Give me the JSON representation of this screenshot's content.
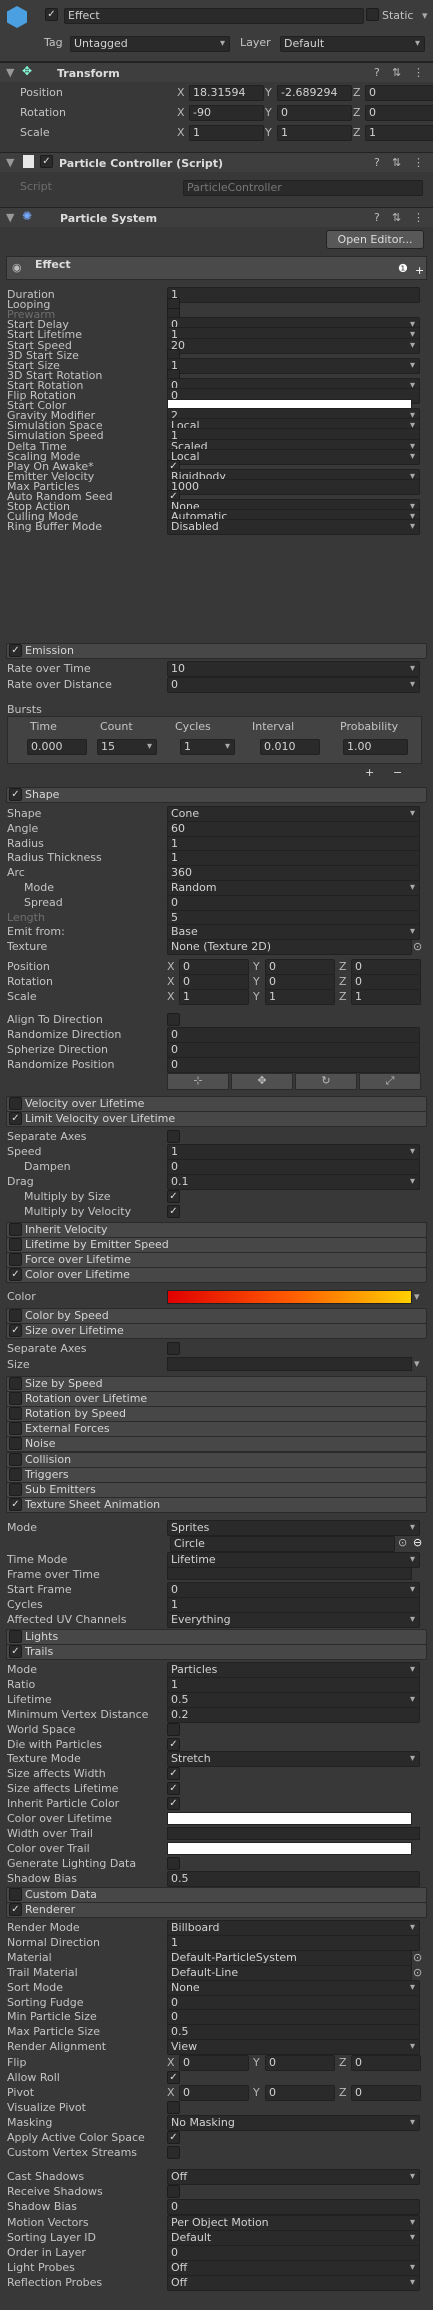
{
  "object": {
    "name": "Effect",
    "static_label": "Static",
    "tag_label": "Tag",
    "tag_value": "Untagged",
    "layer_label": "Layer",
    "layer_value": "Default"
  },
  "transform": {
    "title": "Transform",
    "pos_label": "Position",
    "rot_label": "Rotation",
    "scale_label": "Scale",
    "pos": [
      "18.31594",
      "-2.689294",
      "0"
    ],
    "rot": [
      "-90",
      "0",
      "0"
    ],
    "scale": [
      "1",
      "1",
      "1"
    ]
  },
  "controller": {
    "title": "Particle Controller (Script)",
    "script_label": "Script",
    "script_value": "ParticleController"
  },
  "ps": {
    "title": "Particle System",
    "open_editor": "Open Editor...",
    "effect_tab": "Effect"
  },
  "main_rows": [
    {
      "l": "Duration",
      "v": "1",
      "k": "field"
    },
    {
      "l": "Looping",
      "v": "",
      "k": "check"
    },
    {
      "l": "Prewarm",
      "v": "",
      "k": "dim"
    },
    {
      "l": "Start Delay",
      "v": "0",
      "k": "dd"
    },
    {
      "l": "Start Lifetime",
      "v": "1",
      "k": "dd"
    },
    {
      "l": "Start Speed",
      "v": "20",
      "k": "dd"
    },
    {
      "l": "3D Start Size",
      "v": "",
      "k": "check"
    },
    {
      "l": "Start Size",
      "v": "1",
      "k": "dd"
    },
    {
      "l": "3D Start Rotation",
      "v": "",
      "k": "check"
    },
    {
      "l": "Start Rotation",
      "v": "0",
      "k": "dd"
    },
    {
      "l": "Flip Rotation",
      "v": "0",
      "k": "field"
    },
    {
      "l": "Start Color",
      "v": "",
      "k": "color"
    },
    {
      "l": "Gravity Modifier",
      "v": "2",
      "k": "dd"
    },
    {
      "l": "Simulation Space",
      "v": "Local",
      "k": "dd"
    },
    {
      "l": "Simulation Speed",
      "v": "1",
      "k": "field"
    },
    {
      "l": "Delta Time",
      "v": "Scaled",
      "k": "dd"
    },
    {
      "l": "Scaling Mode",
      "v": "Local",
      "k": "dd"
    },
    {
      "l": "Play On Awake*",
      "v": "✓",
      "k": "check"
    },
    {
      "l": "Emitter Velocity",
      "v": "Rigidbody",
      "k": "dd"
    },
    {
      "l": "Max Particles",
      "v": "1000",
      "k": "field"
    },
    {
      "l": "Auto Random Seed",
      "v": "✓",
      "k": "check"
    },
    {
      "l": "Stop Action",
      "v": "None",
      "k": "dd"
    },
    {
      "l": "Culling Mode",
      "v": "Automatic",
      "k": "dd"
    },
    {
      "l": "Ring Buffer Mode",
      "v": "Disabled",
      "k": "dd"
    }
  ],
  "emission": {
    "title": "Emission",
    "rate_time_label": "Rate over Time",
    "rate_time": "10",
    "rate_dist_label": "Rate over Distance",
    "rate_dist": "0",
    "bursts_label": "Bursts",
    "cols": [
      "Time",
      "Count",
      "Cycles",
      "Interval",
      "Probability"
    ],
    "burst": [
      "0.000",
      "15",
      "1",
      "0.010",
      "1.00"
    ]
  },
  "shape": {
    "title": "Shape",
    "rows": [
      {
        "l": "Shape",
        "v": "Cone",
        "k": "dd"
      },
      {
        "l": "Angle",
        "v": "60",
        "k": "field"
      },
      {
        "l": "Radius",
        "v": "1",
        "k": "field"
      },
      {
        "l": "Radius Thickness",
        "v": "1",
        "k": "field"
      },
      {
        "l": "Arc",
        "v": "360",
        "k": "field"
      },
      {
        "l": "Mode",
        "v": "Random",
        "k": "dd",
        "i": 1
      },
      {
        "l": "Spread",
        "v": "0",
        "k": "field",
        "i": 1
      },
      {
        "l": "Length",
        "v": "5",
        "k": "dimf"
      },
      {
        "l": "Emit from:",
        "v": "Base",
        "k": "dd"
      },
      {
        "l": "Texture",
        "v": "None (Texture 2D)",
        "k": "obj"
      }
    ],
    "pos_label": "Position",
    "rot_label": "Rotation",
    "scale_label": "Scale",
    "pos": [
      "0",
      "0",
      "0"
    ],
    "rot": [
      "0",
      "0",
      "0"
    ],
    "scale": [
      "1",
      "1",
      "1"
    ],
    "align_label": "Align To Direction",
    "rand_dir_label": "Randomize Direction",
    "rand_dir": "0",
    "sph_dir_label": "Spherize Direction",
    "sph_dir": "0",
    "rand_pos_label": "Randomize Position",
    "rand_pos": "0"
  },
  "modules_a": [
    {
      "t": "Velocity over Lifetime",
      "c": false
    },
    {
      "t": "Limit Velocity over Lifetime",
      "c": true
    }
  ],
  "limit": {
    "sep_label": "Separate Axes",
    "speed_label": "Speed",
    "speed": "1",
    "dampen_label": "Dampen",
    "dampen": "0",
    "drag_label": "Drag",
    "drag": "0.1",
    "mult_size_label": "Multiply by Size",
    "mult_vel_label": "Multiply by Velocity"
  },
  "modules_b": [
    {
      "t": "Inherit Velocity",
      "c": false
    },
    {
      "t": "Lifetime by Emitter Speed",
      "c": false
    },
    {
      "t": "Force over Lifetime",
      "c": false
    },
    {
      "t": "Color over Lifetime",
      "c": true
    }
  ],
  "col_life": {
    "label": "Color"
  },
  "modules_c": [
    {
      "t": "Color by Speed",
      "c": false
    },
    {
      "t": "Size over Lifetime",
      "c": true
    }
  ],
  "size_life": {
    "sep_label": "Separate Axes",
    "size_label": "Size"
  },
  "modules_d": [
    {
      "t": "Size by Speed",
      "c": false
    },
    {
      "t": "Rotation over Lifetime",
      "c": false
    },
    {
      "t": "Rotation by Speed",
      "c": false
    },
    {
      "t": "External Forces",
      "c": false
    },
    {
      "t": "Noise",
      "c": false
    },
    {
      "t": "Collision",
      "c": false
    },
    {
      "t": "Triggers",
      "c": false
    },
    {
      "t": "Sub Emitters",
      "c": false
    },
    {
      "t": "Texture Sheet Animation",
      "c": true
    }
  ],
  "tsa": {
    "mode_label": "Mode",
    "mode": "Sprites",
    "sprite": "Circle",
    "time_label": "Time Mode",
    "time": "Lifetime",
    "frame_label": "Frame over Time",
    "start_label": "Start Frame",
    "start": "0",
    "cycles_label": "Cycles",
    "cycles": "1",
    "uv_label": "Affected UV Channels",
    "uv": "Everything"
  },
  "modules_e": [
    {
      "t": "Lights",
      "c": false
    },
    {
      "t": "Trails",
      "c": true
    }
  ],
  "trails": {
    "rows": [
      {
        "l": "Mode",
        "v": "Particles",
        "k": "dd"
      },
      {
        "l": "Ratio",
        "v": "1",
        "k": "field"
      },
      {
        "l": "Lifetime",
        "v": "0.5",
        "k": "dd"
      },
      {
        "l": "Minimum Vertex Distance",
        "v": "0.2",
        "k": "field"
      },
      {
        "l": "World Space",
        "v": "",
        "k": "check"
      },
      {
        "l": "Die with Particles",
        "v": "✓",
        "k": "check"
      },
      {
        "l": "Texture Mode",
        "v": "Stretch",
        "k": "dd"
      },
      {
        "l": "Size affects Width",
        "v": "✓",
        "k": "check"
      },
      {
        "l": "Size affects Lifetime",
        "v": "✓",
        "k": "check"
      },
      {
        "l": "Inherit Particle Color",
        "v": "✓",
        "k": "check"
      },
      {
        "l": "Color over Lifetime",
        "v": "",
        "k": "color"
      },
      {
        "l": "Width over Trail",
        "v": "",
        "k": "curve"
      },
      {
        "l": "Color over Trail",
        "v": "",
        "k": "color"
      },
      {
        "l": "Generate Lighting Data",
        "v": "",
        "k": "check"
      },
      {
        "l": "Shadow Bias",
        "v": "0.5",
        "k": "field"
      }
    ]
  },
  "modules_f": [
    {
      "t": "Custom Data",
      "c": false
    },
    {
      "t": "Renderer",
      "c": true
    }
  ],
  "renderer": {
    "rows": [
      {
        "l": "Render Mode",
        "v": "Billboard",
        "k": "dd"
      },
      {
        "l": "Normal Direction",
        "v": "1",
        "k": "field"
      },
      {
        "l": "Material",
        "v": "Default-ParticleSystem",
        "k": "obj"
      },
      {
        "l": "Trail Material",
        "v": "Default-Line",
        "k": "obj"
      },
      {
        "l": "Sort Mode",
        "v": "None",
        "k": "dd"
      },
      {
        "l": "Sorting Fudge",
        "v": "0",
        "k": "field"
      },
      {
        "l": "Min Particle Size",
        "v": "0",
        "k": "field"
      },
      {
        "l": "Max Particle Size",
        "v": "0.5",
        "k": "field"
      },
      {
        "l": "Render Alignment",
        "v": "View",
        "k": "dd"
      }
    ],
    "flip_label": "Flip",
    "flip": [
      "0",
      "0",
      "0"
    ],
    "roll_label": "Allow Roll",
    "pivot_label": "Pivot",
    "pivot": [
      "0",
      "0",
      "0"
    ],
    "vis_label": "Visualize Pivot",
    "mask_label": "Masking",
    "mask": "No Masking",
    "acs_label": "Apply Active Color Space",
    "cvs_label": "Custom Vertex Streams",
    "rows2": [
      {
        "l": "Cast Shadows",
        "v": "Off",
        "k": "dd"
      },
      {
        "l": "Receive Shadows",
        "v": "",
        "k": "check"
      },
      {
        "l": "Shadow Bias",
        "v": "0",
        "k": "field"
      },
      {
        "l": "Motion Vectors",
        "v": "Per Object Motion",
        "k": "dd"
      },
      {
        "l": "Sorting Layer ID",
        "v": "Default",
        "k": "dd"
      },
      {
        "l": "Order in Layer",
        "v": "0",
        "k": "field"
      },
      {
        "l": "Light Probes",
        "v": "Off",
        "k": "dd"
      },
      {
        "l": "Reflection Probes",
        "v": "Off",
        "k": "dd"
      }
    ]
  },
  "axis": [
    "X",
    "Y",
    "Z"
  ]
}
